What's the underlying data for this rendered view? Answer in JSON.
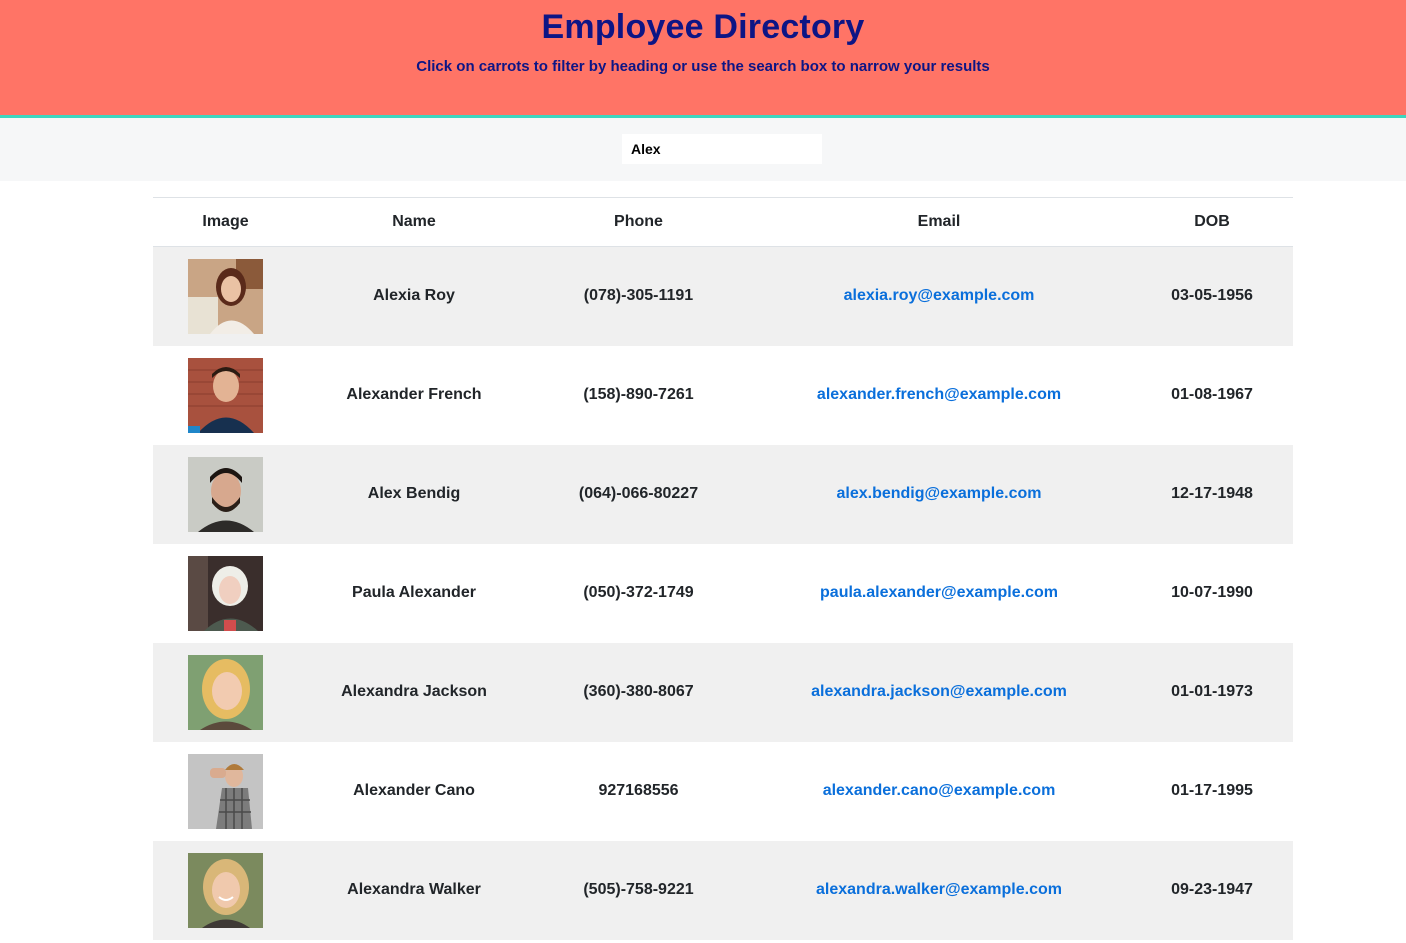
{
  "header": {
    "title": "Employee Directory",
    "subtitle": "Click on carrots to filter by heading or use the search box to narrow your results"
  },
  "search": {
    "value": "Alex"
  },
  "table": {
    "columns": [
      "Image",
      "Name",
      "Phone",
      "Email",
      "DOB"
    ],
    "rows": [
      {
        "name": "Alexia Roy",
        "phone": "(078)-305-1191",
        "email": "alexia.roy@example.com",
        "dob": "03-05-1956",
        "avatar": "portrait-woman-brown-hair-icon"
      },
      {
        "name": "Alexander French",
        "phone": "(158)-890-7261",
        "email": "alexander.french@example.com",
        "dob": "01-08-1967",
        "avatar": "portrait-man-brick-wall-icon"
      },
      {
        "name": "Alex Bendig",
        "phone": "(064)-066-80227",
        "email": "alex.bendig@example.com",
        "dob": "12-17-1948",
        "avatar": "portrait-man-beard-icon"
      },
      {
        "name": "Paula Alexander",
        "phone": "(050)-372-1749",
        "email": "paula.alexander@example.com",
        "dob": "10-07-1990",
        "avatar": "portrait-woman-platinum-hair-icon"
      },
      {
        "name": "Alexandra Jackson",
        "phone": "(360)-380-8067",
        "email": "alexandra.jackson@example.com",
        "dob": "01-01-1973",
        "avatar": "portrait-woman-blonde-icon"
      },
      {
        "name": "Alexander Cano",
        "phone": "927168556",
        "email": "alexander.cano@example.com",
        "dob": "01-17-1995",
        "avatar": "portrait-man-plaid-shirt-icon"
      },
      {
        "name": "Alexandra Walker",
        "phone": "(505)-758-9221",
        "email": "alexandra.walker@example.com",
        "dob": "09-23-1947",
        "avatar": "portrait-woman-smiling-blonde-icon"
      }
    ]
  },
  "colors": {
    "header_bg": "#ff7466",
    "header_text": "#0d1585",
    "accent_border": "#3cd6bf",
    "link": "#0a6fdb",
    "row_stripe": "#f0f0f0"
  }
}
